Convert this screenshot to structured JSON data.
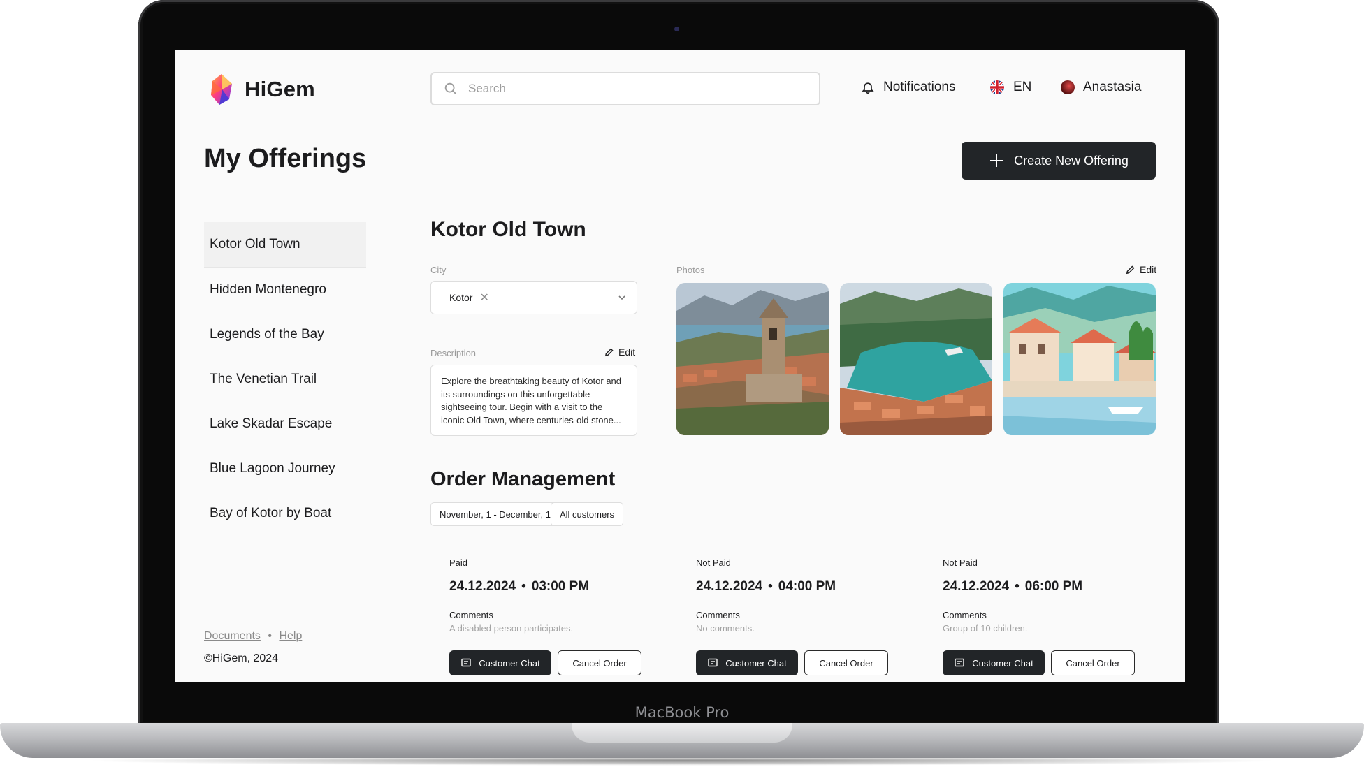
{
  "device": {
    "label": "MacBook Pro"
  },
  "app": {
    "name": "HiGem"
  },
  "header": {
    "search_placeholder": "Search",
    "notifications_label": "Notifications",
    "language": "EN",
    "user_name": "Anastasia"
  },
  "page": {
    "title": "My Offerings",
    "create_button": "Create New Offering"
  },
  "sidebar": {
    "items": [
      {
        "label": "Kotor Old Town",
        "active": true
      },
      {
        "label": "Hidden Montenegro"
      },
      {
        "label": "Legends of the Bay"
      },
      {
        "label": "The Venetian Trail"
      },
      {
        "label": "Lake Skadar Escape"
      },
      {
        "label": "Blue Lagoon Journey"
      },
      {
        "label": "Bay of Kotor by Boat"
      }
    ],
    "footer": {
      "documents": "Documents",
      "separator": "•",
      "help": "Help",
      "copyright": "©HiGem, 2024"
    }
  },
  "offering": {
    "title": "Kotor Old Town",
    "city_label": "City",
    "city_value": "Kotor",
    "description_label": "Description",
    "description_edit": "Edit",
    "description_text": "Explore the breathtaking beauty of Kotor and its surroundings on this unforgettable sightseeing tour. Begin with a visit to the iconic Old Town, where centuries-old stone...",
    "photos_label": "Photos",
    "photos_edit": "Edit"
  },
  "orders": {
    "title": "Order Management",
    "date_filter": "November, 1 - December, 1",
    "customer_filter": "All customers",
    "items": [
      {
        "status": "Paid",
        "date": "24.12.2024",
        "time": "03:00 PM",
        "comments_label": "Comments",
        "comments": "A disabled person participates.",
        "chat": "Customer Chat",
        "cancel": "Cancel Order"
      },
      {
        "status": "Not Paid",
        "date": "24.12.2024",
        "time": "04:00 PM",
        "comments_label": "Comments",
        "comments": "No comments.",
        "chat": "Customer Chat",
        "cancel": "Cancel Order"
      },
      {
        "status": "Not Paid",
        "date": "24.12.2024",
        "time": "06:00 PM",
        "comments_label": "Comments",
        "comments": "Group of 10 children.",
        "chat": "Customer Chat",
        "cancel": "Cancel Order"
      }
    ]
  },
  "colors": {
    "primary_dark": "#222528",
    "background": "#fafafa",
    "muted_text": "#9a9a9a"
  }
}
